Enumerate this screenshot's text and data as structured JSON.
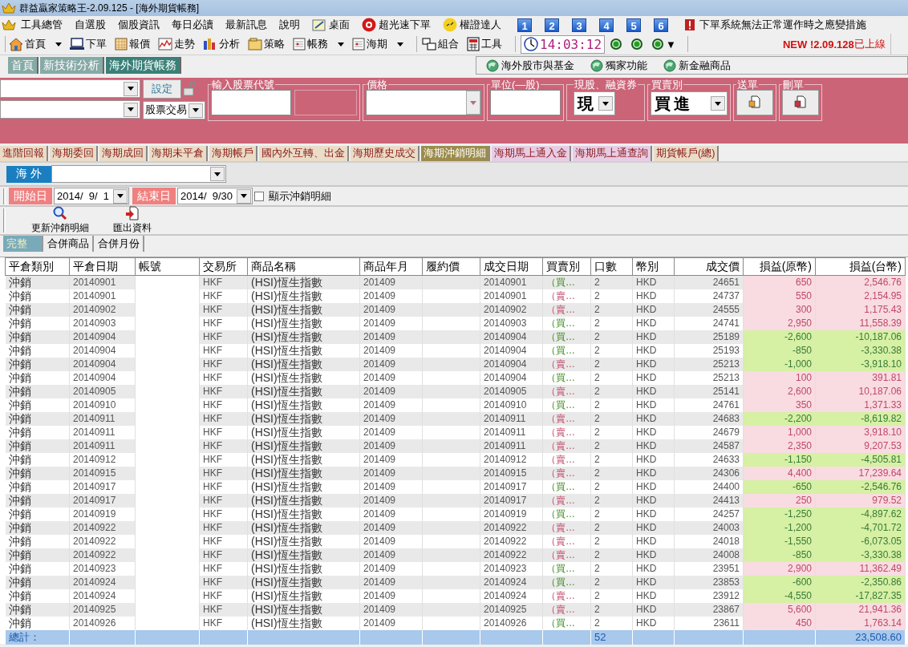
{
  "window": {
    "title": "群益贏家策略王-2.09.125 - [海外期貨帳務]"
  },
  "menu": [
    {
      "label": "工具總管",
      "kind": "plain"
    },
    {
      "label": "自選股",
      "kind": "plain"
    },
    {
      "label": "個股資訊",
      "kind": "plain"
    },
    {
      "label": "每日必讀",
      "kind": "plain"
    },
    {
      "label": "最新訊息",
      "kind": "plain"
    },
    {
      "label": "說明",
      "kind": "plain"
    },
    {
      "label": "桌面",
      "kind": "iconic"
    },
    {
      "label": "超光速下單",
      "kind": "iconic"
    },
    {
      "label": "權證達人",
      "kind": "iconic"
    },
    {
      "label": "1",
      "kind": "number"
    },
    {
      "label": "2",
      "kind": "number"
    },
    {
      "label": "3",
      "kind": "number"
    },
    {
      "label": "4",
      "kind": "number"
    },
    {
      "label": "5",
      "kind": "number"
    },
    {
      "label": "6",
      "kind": "number"
    },
    {
      "label": "下單系統無法正常運作時之應變措施",
      "kind": "notice"
    }
  ],
  "toolbar": [
    {
      "label": "首頁",
      "dropdown": true
    },
    {
      "label": "下單",
      "dropdown": false
    },
    {
      "label": "報價",
      "dropdown": false
    },
    {
      "label": "走勢",
      "dropdown": false
    },
    {
      "label": "分析",
      "dropdown": false
    },
    {
      "label": "策略",
      "dropdown": false
    },
    {
      "label": "帳務",
      "dropdown": true
    },
    {
      "label": "海期",
      "dropdown": true
    },
    {
      "label": "組合",
      "dropdown": false
    },
    {
      "label": "工具",
      "dropdown": false
    }
  ],
  "clock": "14:03:12",
  "lights_menu": "▼",
  "update_notice": "**NEW !2.09.128**已上線",
  "window_tabs": [
    {
      "label": "首頁",
      "selected": false
    },
    {
      "label": "新技術分析",
      "selected": false
    },
    {
      "label": "海外期貨帳務",
      "selected": true
    }
  ],
  "quick_links": [
    "海外股市與基金",
    "獨家功能",
    "新金融商品"
  ],
  "order_panel": {
    "set_button": "設定",
    "trade_type": "股票交易",
    "code_label": "輸入股票代號",
    "price_label": "價格",
    "unit_label": "單位(—股)",
    "cash_label": "現股、融資券",
    "cash_value": "現",
    "side_label": "買賣別",
    "side_value": "買進",
    "send_label": "送單",
    "delete_label": "刪單"
  },
  "sub_tabs": [
    {
      "label": "進階回報",
      "selected": false,
      "color": "#eadcc6"
    },
    {
      "label": "海期委回",
      "selected": false,
      "color": "#eadcc6"
    },
    {
      "label": "海期成回",
      "selected": false,
      "color": "#eadcc6"
    },
    {
      "label": "海期未平倉",
      "selected": false,
      "color": "#eadcc6"
    },
    {
      "label": "海期帳戶",
      "selected": false,
      "color": "#eadcc6"
    },
    {
      "label": "國內外互轉、出金",
      "selected": false,
      "color": "#eadcc6"
    },
    {
      "label": "海期歷史成交",
      "selected": false,
      "color": "#eadcc6"
    },
    {
      "label": "海期沖銷明細",
      "selected": true,
      "color": "#9c8c4c"
    },
    {
      "label": "海期馬上通入金",
      "selected": false,
      "color": "#e8cce4"
    },
    {
      "label": "海期馬上通查詢",
      "selected": false,
      "color": "#e8cce4"
    },
    {
      "label": "期貨帳戶(總)",
      "selected": false,
      "color": "#eadcc6"
    }
  ],
  "market_label": "海 外",
  "filter": {
    "start_label": "開始日",
    "start_date": "2014/  9/  1",
    "end_label": "結束日",
    "end_date": "2014/  9/30",
    "show_detail_label": "顯示沖銷明細",
    "show_detail": false
  },
  "actions": [
    "更新沖銷明細",
    "匯出資料"
  ],
  "view_tabs": [
    {
      "label": "完整",
      "selected": true
    },
    {
      "label": "合併商品",
      "selected": false
    },
    {
      "label": "合併月份",
      "selected": false
    }
  ],
  "table": {
    "columns": [
      "平倉類別",
      "平倉日期",
      "帳號",
      "交易所",
      "商品名稱",
      "商品年月",
      "履約價",
      "成交日期",
      "買賣別",
      "口數",
      "幣別",
      "成交價",
      "損益(原幣)",
      "損益(台幣)"
    ],
    "rows": [
      {
        "type": "沖銷",
        "close_date": "20140901",
        "exchange": "HKF",
        "product": "(HSI)恆生指數",
        "month": "201409",
        "trade_date": "20140901",
        "side": "（買…",
        "kind": "buy",
        "lots": "2",
        "currency": "HKD",
        "price": "24651",
        "pnl": "650",
        "pnl_twd": "2,546.76",
        "profit": true
      },
      {
        "type": "沖銷",
        "close_date": "20140901",
        "exchange": "HKF",
        "product": "(HSI)恆生指數",
        "month": "201409",
        "trade_date": "20140901",
        "side": "（賣…",
        "kind": "sell",
        "lots": "2",
        "currency": "HKD",
        "price": "24737",
        "pnl": "550",
        "pnl_twd": "2,154.95",
        "profit": true
      },
      {
        "type": "沖銷",
        "close_date": "20140902",
        "exchange": "HKF",
        "product": "(HSI)恆生指數",
        "month": "201409",
        "trade_date": "20140902",
        "side": "（賣…",
        "kind": "sell",
        "lots": "2",
        "currency": "HKD",
        "price": "24555",
        "pnl": "300",
        "pnl_twd": "1,175.43",
        "profit": true
      },
      {
        "type": "沖銷",
        "close_date": "20140903",
        "exchange": "HKF",
        "product": "(HSI)恆生指數",
        "month": "201409",
        "trade_date": "20140903",
        "side": "（買…",
        "kind": "buy",
        "lots": "2",
        "currency": "HKD",
        "price": "24741",
        "pnl": "2,950",
        "pnl_twd": "11,558.39",
        "profit": true
      },
      {
        "type": "沖銷",
        "close_date": "20140904",
        "exchange": "HKF",
        "product": "(HSI)恆生指數",
        "month": "201409",
        "trade_date": "20140904",
        "side": "（買…",
        "kind": "buy",
        "lots": "2",
        "currency": "HKD",
        "price": "25189",
        "pnl": "-2,600",
        "pnl_twd": "-10,187.06",
        "profit": false
      },
      {
        "type": "沖銷",
        "close_date": "20140904",
        "exchange": "HKF",
        "product": "(HSI)恆生指數",
        "month": "201409",
        "trade_date": "20140904",
        "side": "（買…",
        "kind": "buy",
        "lots": "2",
        "currency": "HKD",
        "price": "25193",
        "pnl": "-850",
        "pnl_twd": "-3,330.38",
        "profit": false
      },
      {
        "type": "沖銷",
        "close_date": "20140904",
        "exchange": "HKF",
        "product": "(HSI)恆生指數",
        "month": "201409",
        "trade_date": "20140904",
        "side": "（賣…",
        "kind": "sell",
        "lots": "2",
        "currency": "HKD",
        "price": "25213",
        "pnl": "-1,000",
        "pnl_twd": "-3,918.10",
        "profit": false
      },
      {
        "type": "沖銷",
        "close_date": "20140904",
        "exchange": "HKF",
        "product": "(HSI)恆生指數",
        "month": "201409",
        "trade_date": "20140904",
        "side": "（買…",
        "kind": "buy",
        "lots": "2",
        "currency": "HKD",
        "price": "25213",
        "pnl": "100",
        "pnl_twd": "391.81",
        "profit": true
      },
      {
        "type": "沖銷",
        "close_date": "20140905",
        "exchange": "HKF",
        "product": "(HSI)恆生指數",
        "month": "201409",
        "trade_date": "20140905",
        "side": "（賣…",
        "kind": "sell",
        "lots": "2",
        "currency": "HKD",
        "price": "25141",
        "pnl": "2,600",
        "pnl_twd": "10,187.06",
        "profit": true
      },
      {
        "type": "沖銷",
        "close_date": "20140910",
        "exchange": "HKF",
        "product": "(HSI)恆生指數",
        "month": "201409",
        "trade_date": "20140910",
        "side": "（買…",
        "kind": "buy",
        "lots": "2",
        "currency": "HKD",
        "price": "24761",
        "pnl": "350",
        "pnl_twd": "1,371.33",
        "profit": true
      },
      {
        "type": "沖銷",
        "close_date": "20140911",
        "exchange": "HKF",
        "product": "(HSI)恆生指數",
        "month": "201409",
        "trade_date": "20140911",
        "side": "（賣…",
        "kind": "sell",
        "lots": "2",
        "currency": "HKD",
        "price": "24683",
        "pnl": "-2,200",
        "pnl_twd": "-8,619.82",
        "profit": false
      },
      {
        "type": "沖銷",
        "close_date": "20140911",
        "exchange": "HKF",
        "product": "(HSI)恆生指數",
        "month": "201409",
        "trade_date": "20140911",
        "side": "（賣…",
        "kind": "sell",
        "lots": "2",
        "currency": "HKD",
        "price": "24679",
        "pnl": "1,000",
        "pnl_twd": "3,918.10",
        "profit": true
      },
      {
        "type": "沖銷",
        "close_date": "20140911",
        "exchange": "HKF",
        "product": "(HSI)恆生指數",
        "month": "201409",
        "trade_date": "20140911",
        "side": "（賣…",
        "kind": "sell",
        "lots": "2",
        "currency": "HKD",
        "price": "24587",
        "pnl": "2,350",
        "pnl_twd": "9,207.53",
        "profit": true
      },
      {
        "type": "沖銷",
        "close_date": "20140912",
        "exchange": "HKF",
        "product": "(HSI)恆生指數",
        "month": "201409",
        "trade_date": "20140912",
        "side": "（賣…",
        "kind": "sell",
        "lots": "2",
        "currency": "HKD",
        "price": "24633",
        "pnl": "-1,150",
        "pnl_twd": "-4,505.81",
        "profit": false
      },
      {
        "type": "沖銷",
        "close_date": "20140915",
        "exchange": "HKF",
        "product": "(HSI)恆生指數",
        "month": "201409",
        "trade_date": "20140915",
        "side": "（賣…",
        "kind": "sell",
        "lots": "2",
        "currency": "HKD",
        "price": "24306",
        "pnl": "4,400",
        "pnl_twd": "17,239.64",
        "profit": true
      },
      {
        "type": "沖銷",
        "close_date": "20140917",
        "exchange": "HKF",
        "product": "(HSI)恆生指數",
        "month": "201409",
        "trade_date": "20140917",
        "side": "（買…",
        "kind": "buy",
        "lots": "2",
        "currency": "HKD",
        "price": "24400",
        "pnl": "-650",
        "pnl_twd": "-2,546.76",
        "profit": false
      },
      {
        "type": "沖銷",
        "close_date": "20140917",
        "exchange": "HKF",
        "product": "(HSI)恆生指數",
        "month": "201409",
        "trade_date": "20140917",
        "side": "（賣…",
        "kind": "sell",
        "lots": "2",
        "currency": "HKD",
        "price": "24413",
        "pnl": "250",
        "pnl_twd": "979.52",
        "profit": true
      },
      {
        "type": "沖銷",
        "close_date": "20140919",
        "exchange": "HKF",
        "product": "(HSI)恆生指數",
        "month": "201409",
        "trade_date": "20140919",
        "side": "（買…",
        "kind": "buy",
        "lots": "2",
        "currency": "HKD",
        "price": "24257",
        "pnl": "-1,250",
        "pnl_twd": "-4,897.62",
        "profit": false
      },
      {
        "type": "沖銷",
        "close_date": "20140922",
        "exchange": "HKF",
        "product": "(HSI)恆生指數",
        "month": "201409",
        "trade_date": "20140922",
        "side": "（賣…",
        "kind": "sell",
        "lots": "2",
        "currency": "HKD",
        "price": "24003",
        "pnl": "-1,200",
        "pnl_twd": "-4,701.72",
        "profit": false
      },
      {
        "type": "沖銷",
        "close_date": "20140922",
        "exchange": "HKF",
        "product": "(HSI)恆生指數",
        "month": "201409",
        "trade_date": "20140922",
        "side": "（賣…",
        "kind": "sell",
        "lots": "2",
        "currency": "HKD",
        "price": "24018",
        "pnl": "-1,550",
        "pnl_twd": "-6,073.05",
        "profit": false
      },
      {
        "type": "沖銷",
        "close_date": "20140922",
        "exchange": "HKF",
        "product": "(HSI)恆生指數",
        "month": "201409",
        "trade_date": "20140922",
        "side": "（賣…",
        "kind": "sell",
        "lots": "2",
        "currency": "HKD",
        "price": "24008",
        "pnl": "-850",
        "pnl_twd": "-3,330.38",
        "profit": false
      },
      {
        "type": "沖銷",
        "close_date": "20140923",
        "exchange": "HKF",
        "product": "(HSI)恆生指數",
        "month": "201409",
        "trade_date": "20140923",
        "side": "（買…",
        "kind": "buy",
        "lots": "2",
        "currency": "HKD",
        "price": "23951",
        "pnl": "2,900",
        "pnl_twd": "11,362.49",
        "profit": true
      },
      {
        "type": "沖銷",
        "close_date": "20140924",
        "exchange": "HKF",
        "product": "(HSI)恆生指數",
        "month": "201409",
        "trade_date": "20140924",
        "side": "（買…",
        "kind": "buy",
        "lots": "2",
        "currency": "HKD",
        "price": "23853",
        "pnl": "-600",
        "pnl_twd": "-2,350.86",
        "profit": false
      },
      {
        "type": "沖銷",
        "close_date": "20140924",
        "exchange": "HKF",
        "product": "(HSI)恆生指數",
        "month": "201409",
        "trade_date": "20140924",
        "side": "（賣…",
        "kind": "sell",
        "lots": "2",
        "currency": "HKD",
        "price": "23912",
        "pnl": "-4,550",
        "pnl_twd": "-17,827.35",
        "profit": false
      },
      {
        "type": "沖銷",
        "close_date": "20140925",
        "exchange": "HKF",
        "product": "(HSI)恆生指數",
        "month": "201409",
        "trade_date": "20140925",
        "side": "（賣…",
        "kind": "sell",
        "lots": "2",
        "currency": "HKD",
        "price": "23867",
        "pnl": "5,600",
        "pnl_twd": "21,941.36",
        "profit": true
      },
      {
        "type": "沖銷",
        "close_date": "20140926",
        "exchange": "HKF",
        "product": "(HSI)恆生指數",
        "month": "201409",
        "trade_date": "20140926",
        "side": "（買…",
        "kind": "buy",
        "lots": "2",
        "currency": "HKD",
        "price": "23611",
        "pnl": "450",
        "pnl_twd": "1,763.14",
        "profit": true
      }
    ],
    "total": {
      "label": "總計：",
      "lots": "52",
      "pnl_twd": "23,508.60"
    }
  }
}
